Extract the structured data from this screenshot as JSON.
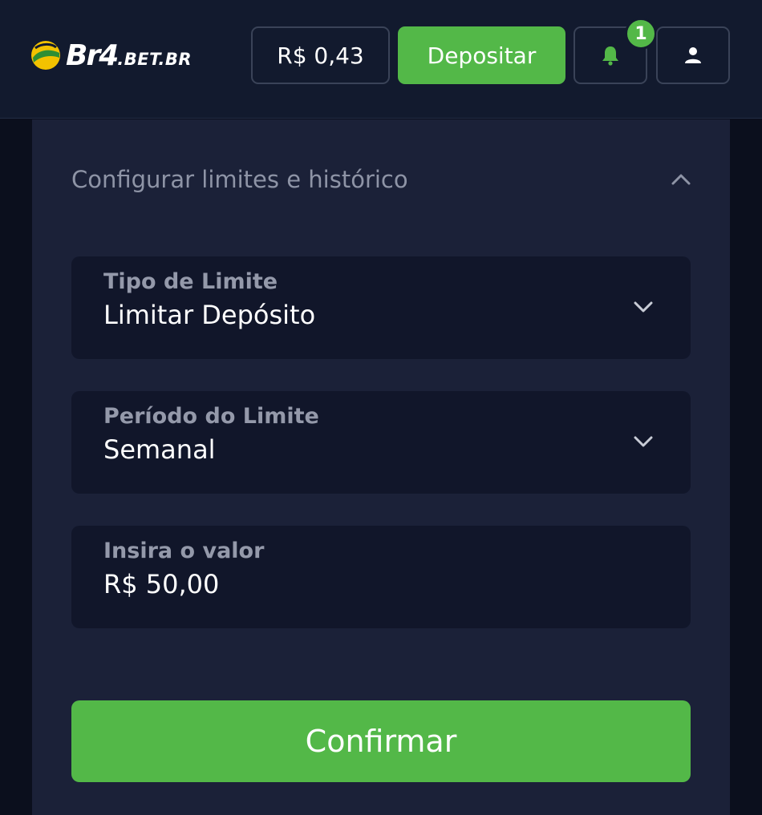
{
  "header": {
    "logo": {
      "main": "Br4",
      "suffix": ".BET.BR"
    },
    "balance": "R$ 0,43",
    "deposit_label": "Depositar",
    "notification_count": "1"
  },
  "panel": {
    "section_title": "Configurar limites e histórico",
    "fields": [
      {
        "label": "Tipo de Limite",
        "value": "Limitar Depósito"
      },
      {
        "label": "Período do Limite",
        "value": "Semanal"
      },
      {
        "label": "Insira o valor",
        "value": "R$ 50,00"
      }
    ],
    "confirm_label": "Confirmar"
  },
  "icons": {
    "bell": "bell-icon",
    "user": "user-icon",
    "collapse": "chevron-up-icon",
    "dropdown": "chevron-down-icon"
  },
  "colors": {
    "accent_green": "#53b848",
    "header_bg": "#121a2e",
    "panel_bg": "#1b2138",
    "field_bg": "#11162a",
    "page_bg": "#0b0f1d"
  }
}
